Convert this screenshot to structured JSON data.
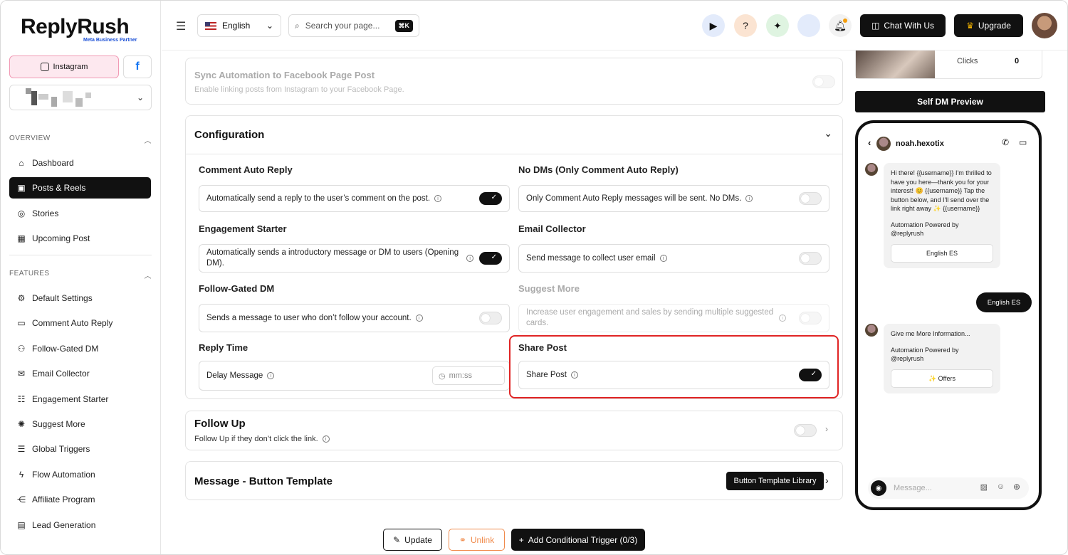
{
  "brand": {
    "name": "ReplyRush",
    "subtitle": "Meta Business Partner"
  },
  "platforms": {
    "instagram_label": "Instagram",
    "facebook_label": "f"
  },
  "sidebar": {
    "overview_title": "OVERVIEW",
    "overview_items": [
      "Dashboard",
      "Posts & Reels",
      "Stories",
      "Upcoming Post"
    ],
    "features_title": "FEATURES",
    "feature_items": [
      "Default Settings",
      "Comment Auto Reply",
      "Follow-Gated DM",
      "Email Collector",
      "Engagement Starter",
      "Suggest More",
      "Global Triggers",
      "Flow Automation",
      "Affiliate Program",
      "Lead Generation"
    ],
    "active_item": "Posts & Reels"
  },
  "topbar": {
    "language": "English",
    "search_placeholder": "Search your page...",
    "shortcut": "⌘K",
    "chat_label": "Chat With Us",
    "upgrade_label": "Upgrade"
  },
  "sync": {
    "title": "Sync Automation to Facebook Page Post",
    "desc": "Enable linking posts from Instagram to your Facebook Page.",
    "enabled": false
  },
  "config": {
    "title": "Configuration",
    "comment_auto_reply": {
      "label": "Comment Auto Reply",
      "text": "Automatically send a reply to the user’s comment on the post.",
      "enabled": true
    },
    "no_dms": {
      "label": "No DMs (Only Comment Auto Reply)",
      "text": "Only Comment Auto Reply messages will be sent. No DMs.",
      "enabled": false
    },
    "engagement_starter": {
      "label": "Engagement Starter",
      "text": "Automatically sends a introductory message or DM to users (Opening DM).",
      "enabled": true
    },
    "email_collector": {
      "label": "Email Collector",
      "text": "Send message to collect user email",
      "enabled": false
    },
    "follow_gated": {
      "label": "Follow-Gated DM",
      "text": "Sends a message to user who don’t follow your account.",
      "enabled": false
    },
    "suggest_more": {
      "label": "Suggest More",
      "text": "Increase user engagement and sales by sending multiple suggested cards.",
      "enabled": false
    },
    "reply_time": {
      "label": "Reply Time",
      "text": "Delay Message",
      "placeholder": "mm:ss"
    },
    "share_post": {
      "label": "Share Post",
      "text": "Share Post",
      "enabled": true
    }
  },
  "follow_up": {
    "title": "Follow Up",
    "desc": "Follow Up if they don’t click the link.",
    "enabled": false
  },
  "message_template": {
    "title": "Message - Button Template",
    "library_label": "Button Template Library"
  },
  "actions": {
    "update": "Update",
    "unlink": "Unlink",
    "add_trigger": "Add Conditional Trigger (0/3)"
  },
  "stats": {
    "clicks_label": "Clicks",
    "clicks_value": "0"
  },
  "preview": {
    "button_label": "Self DM Preview",
    "username": "noah.hexotix",
    "msg1": "Hi there! {{username}} I'm thrilled to have you here—thank you for your interest! 😊 {{username}} Tap the button below, and I'll send over the link right away ✨ {{username}}",
    "powered1": "Automation Powered by @replyrush",
    "btn1": "English ES",
    "reply": "English ES",
    "msg2": "Give me More Information...",
    "powered2": "Automation Powered by @replyrush",
    "btn2": "✨ Offers",
    "input_placeholder": "Message..."
  },
  "colors": {
    "accent": "#111111",
    "highlight": "#e02424",
    "instagram_bg": "#fde8ef",
    "unlink": "#f08a4b"
  }
}
